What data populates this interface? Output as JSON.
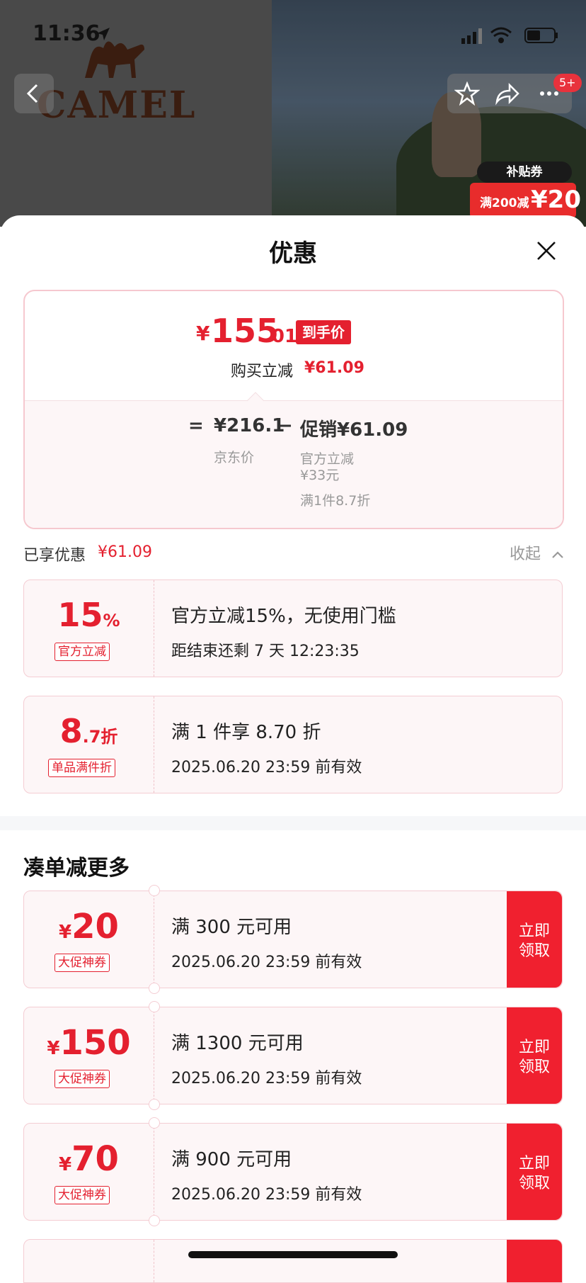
{
  "status_bar": {
    "time": "11:36"
  },
  "background": {
    "brand_text": "CAMEL",
    "header_badge": "5+",
    "subsidy_tag": "补贴券",
    "subsidy_coupon_cond": "满200减",
    "subsidy_coupon_value": "¥20"
  },
  "sheet": {
    "title": "优惠",
    "summary": {
      "yen": "¥",
      "price_int": "155",
      "price_dec": ".01",
      "price_tag": "到手价",
      "buy_reduce_label": "购买立减",
      "buy_reduce_value": "¥61.09",
      "eq": "=",
      "jd_price": "¥216.1",
      "minus": "−",
      "promo": "促销¥61.09",
      "jd_label": "京东价",
      "promo_detail_1": "官方立减",
      "promo_detail_2": "¥33元",
      "promo_detail_3": "满1件8.7折"
    },
    "enjoyed": {
      "label": "已享优惠",
      "value": "¥61.09",
      "collapse": "收起"
    },
    "applied": [
      {
        "big": "15",
        "unit": "%",
        "tag": "官方立减",
        "line1": "官方立减15%，无使用门槛",
        "line2": "距结束还剩 7 天 12:23:35"
      },
      {
        "big": "8",
        "unit": ".7折",
        "tag": "单品满件折",
        "line1": "满 1 件享 8.70 折",
        "line2": "2025.06.20 23:59 前有效"
      }
    ],
    "more_title": "凑单减更多",
    "more": [
      {
        "yen": "¥",
        "big": "20",
        "tag": "大促神券",
        "line1": "满 300 元可用",
        "line2": "2025.06.20 23:59 前有效",
        "claim_1": "立即",
        "claim_2": "领取"
      },
      {
        "yen": "¥",
        "big": "150",
        "tag": "大促神券",
        "line1": "满 1300 元可用",
        "line2": "2025.06.20 23:59 前有效",
        "claim_1": "立即",
        "claim_2": "领取"
      },
      {
        "yen": "¥",
        "big": "70",
        "tag": "大促神券",
        "line1": "满 900 元可用",
        "line2": "2025.06.20 23:59 前有效",
        "claim_1": "立即",
        "claim_2": "领取"
      }
    ]
  },
  "colors": {
    "accent": "#e4202f",
    "card_bg": "#fdf6f7",
    "card_border": "#f4cdd3"
  }
}
